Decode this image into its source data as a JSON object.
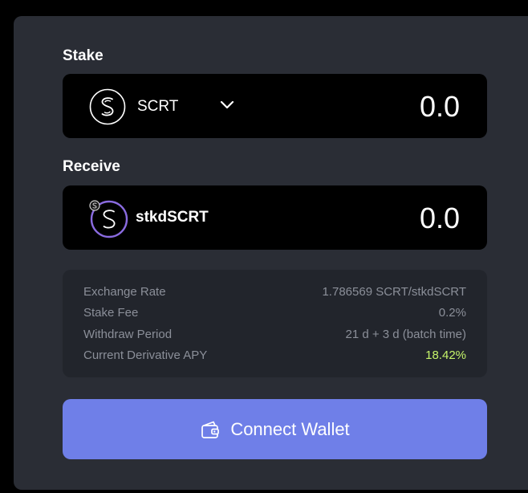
{
  "stake": {
    "label": "Stake",
    "token": "SCRT",
    "amount": "0.0",
    "icon": "secret-logo-icon",
    "dropdown_icon": "chevron-down-icon"
  },
  "receive": {
    "label": "Receive",
    "token": "stkdSCRT",
    "amount": "0.0",
    "icon": "stkd-secret-logo-icon"
  },
  "info": {
    "exchange_rate": {
      "label": "Exchange Rate",
      "value": "1.786569 SCRT/stkdSCRT"
    },
    "stake_fee": {
      "label": "Stake Fee",
      "value": "0.2%"
    },
    "withdraw_period": {
      "label": "Withdraw Period",
      "value": "21 d + 3 d (batch time)"
    },
    "apy": {
      "label": "Current Derivative APY",
      "value": "18.42%"
    }
  },
  "button": {
    "label": "Connect Wallet",
    "icon": "wallet-icon"
  },
  "colors": {
    "panel_bg": "#2a2d35",
    "box_bg": "#000000",
    "info_bg": "#22252c",
    "muted_text": "#8b8f99",
    "apy_green": "#c6f56a",
    "button_bg": "#6f7fe8",
    "stkd_ring": "#8a6be0"
  }
}
